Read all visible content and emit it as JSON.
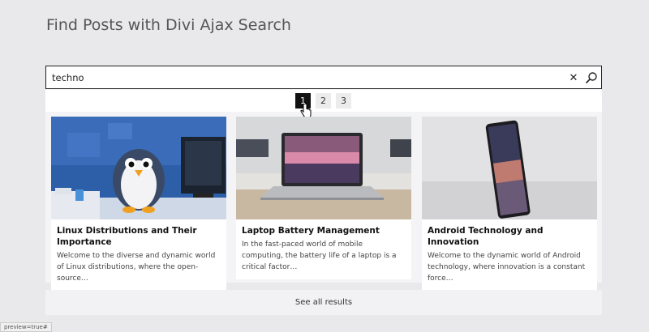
{
  "page": {
    "title": "Find Posts with Divi Ajax Search"
  },
  "search": {
    "value": "techno",
    "clear_icon": "close-icon",
    "search_icon": "magnifier-icon"
  },
  "pagination": {
    "pages": [
      "1",
      "2",
      "3"
    ],
    "active": "1"
  },
  "results": [
    {
      "title": "Linux Distributions and Their Importance",
      "excerpt": "Welcome to the diverse and dynamic world of Linux distributions, where the open-source…",
      "image": "penguin-at-desk-image"
    },
    {
      "title": "Laptop Battery Management",
      "excerpt": "In the fast-paced world of mobile computing, the battery life of a laptop is a critical factor…",
      "image": "laptop-on-desk-image"
    },
    {
      "title": "Android Technology and Innovation",
      "excerpt": "Welcome to the dynamic world of Android technology, where innovation is a constant force…",
      "image": "smartphone-image"
    }
  ],
  "see_all": {
    "label": "See all results"
  },
  "status_bar": {
    "url": "preview=true#"
  },
  "colors": {
    "background": "#e9e9ec",
    "active_page": "#111111",
    "border": "#222222"
  }
}
